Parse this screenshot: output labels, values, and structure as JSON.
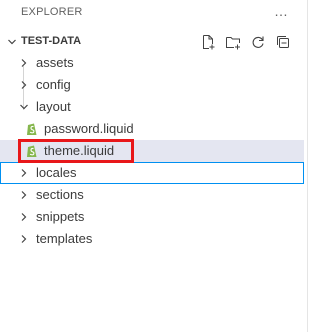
{
  "explorer": {
    "title": "EXPLORER",
    "more_icon": "…"
  },
  "workspace": {
    "name": "TEST-DATA",
    "actions": [
      {
        "icon": "new-file-icon"
      },
      {
        "icon": "new-folder-icon"
      },
      {
        "icon": "refresh-icon"
      },
      {
        "icon": "collapse-all-icon"
      }
    ]
  },
  "tree": {
    "assets": "assets",
    "config": "config",
    "layout": "layout",
    "password_liquid": "password.liquid",
    "theme_liquid": "theme.liquid",
    "locales": "locales",
    "sections": "sections",
    "snippets": "snippets",
    "templates": "templates"
  },
  "colors": {
    "liquid_icon": "#86b74e",
    "highlight": "#e8171a",
    "focus_outline": "#0090f1",
    "selection": "#e4e6f1"
  }
}
